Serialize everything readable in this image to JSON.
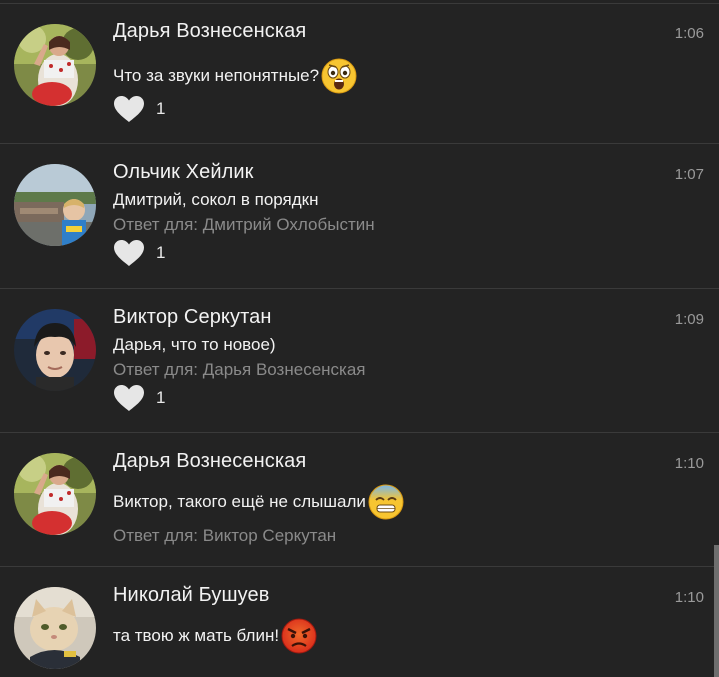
{
  "comments": [
    {
      "author": "Дарья Вознесенская",
      "time": "1:06",
      "text": "Что за звуки непонятные?",
      "emoji": "astonished-face-emoji",
      "likes": "1"
    },
    {
      "author": "Ольчик Хейлик",
      "time": "1:07",
      "text": "Дмитрий, сокол в порядкн",
      "reply_to": "Ответ для: Дмитрий Охлобыстин",
      "likes": "1"
    },
    {
      "author": "Виктор Серкутан",
      "time": "1:09",
      "text": "Дарья, что то новое)",
      "reply_to": "Ответ для: Дарья Вознесенская",
      "likes": "1"
    },
    {
      "author": "Дарья Вознесенская",
      "time": "1:10",
      "text": "Виктор, такого ещё не слышали",
      "emoji": "cold-sweat-face-emoji",
      "reply_to": "Ответ для: Виктор Серкутан"
    },
    {
      "author": "Николай Бушуев",
      "time": "1:10",
      "text": "та твою ж мать блин!",
      "emoji": "angry-face-emoji"
    }
  ],
  "icons": {
    "like": "heart-icon"
  },
  "colors": {
    "background": "#232323",
    "divider": "#3a3a3a",
    "primary_text": "#f2f2f2",
    "secondary_text": "#8a8a8a",
    "heart": "#e6e6e6"
  }
}
